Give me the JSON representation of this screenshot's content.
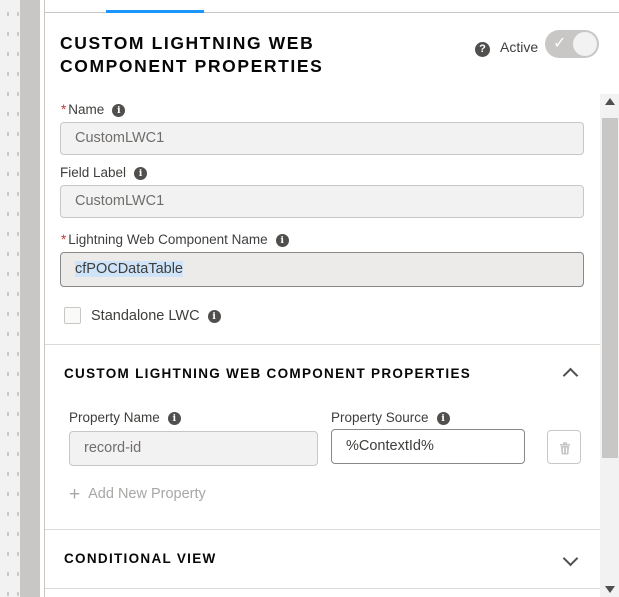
{
  "header": {
    "title": "CUSTOM LIGHTNING WEB COMPONENT PROPERTIES",
    "active_label": "Active",
    "help_glyph": "?"
  },
  "fields": {
    "name": {
      "label": "Name",
      "required_mark": "*",
      "value": "CustomLWC1"
    },
    "field_label": {
      "label": "Field Label",
      "value": "CustomLWC1"
    },
    "lwc_name": {
      "label": "Lightning Web Component Name",
      "required_mark": "*",
      "value": "cfPOCDataTable"
    },
    "standalone": {
      "label": "Standalone LWC",
      "checked": false
    }
  },
  "info_glyph": "i",
  "custom_props_section": {
    "title": "CUSTOM LIGHTNING WEB COMPONENT PROPERTIES",
    "expanded": true,
    "property_name_label": "Property Name",
    "property_source_label": "Property Source",
    "rows": [
      {
        "name": "record-id",
        "source": "%ContextId%"
      }
    ],
    "add_label": "Add New Property",
    "add_glyph": "+"
  },
  "conditional_view_section": {
    "title": "CONDITIONAL VIEW",
    "expanded": false
  },
  "colors": {
    "accent": "#1b96ff",
    "required": "#c23934",
    "text": "#3e3e3c",
    "border": "#c9c7c5"
  },
  "icons": {
    "help": "question-circle-icon",
    "info": "info-icon",
    "toggle_check": "check-icon",
    "collapse": "chevron-up-icon",
    "expand": "chevron-down-icon",
    "delete": "trash-icon",
    "add": "plus-icon"
  }
}
